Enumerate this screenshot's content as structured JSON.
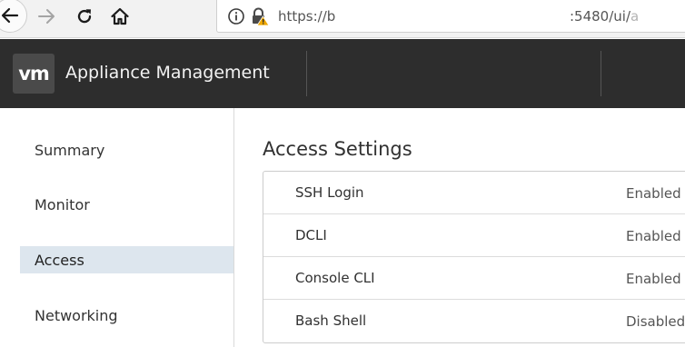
{
  "browser": {
    "icons": {
      "back": "arrow-left-icon",
      "forward": "arrow-right-icon",
      "reload": "reload-icon",
      "home": "home-icon",
      "info": "info-icon",
      "lock": "lock-warning-icon"
    },
    "url_start": "https://b",
    "url_end_visible": ":5480/ui/",
    "url_end_faded": "a"
  },
  "header": {
    "logo_text": "vm",
    "title": "Appliance Management"
  },
  "sidebar": {
    "items": [
      {
        "label": "Summary",
        "active": false
      },
      {
        "label": "Monitor",
        "active": false
      },
      {
        "label": "Access",
        "active": true
      },
      {
        "label": "Networking",
        "active": false
      }
    ]
  },
  "main": {
    "title": "Access Settings",
    "rows": [
      {
        "label": "SSH Login",
        "value": "Enabled"
      },
      {
        "label": "DCLI",
        "value": "Enabled"
      },
      {
        "label": "Console CLI",
        "value": "Enabled"
      },
      {
        "label": "Bash Shell",
        "value": "Disabled"
      }
    ]
  },
  "colors": {
    "header_bg": "#2d2d2d",
    "active_nav_bg": "#dde6ee",
    "lock_warning": "#e8a400"
  }
}
